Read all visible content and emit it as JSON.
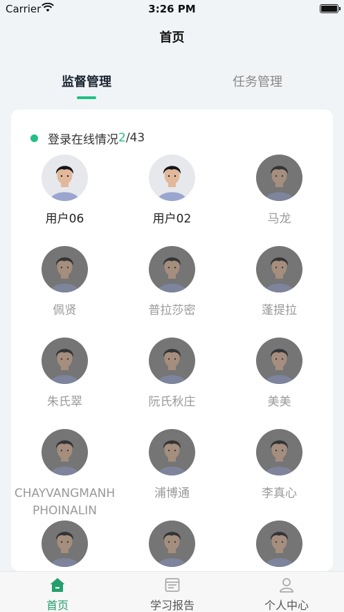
{
  "status_bar": {
    "carrier": "Carrier",
    "time": "3:26 PM"
  },
  "nav": {
    "title": "首页"
  },
  "tabs": [
    {
      "label": "监督管理",
      "active": true
    },
    {
      "label": "任务管理",
      "active": false
    }
  ],
  "online": {
    "label": "登录在线情况",
    "online_count": "2",
    "separator_total": "/43"
  },
  "users": [
    {
      "name": "用户06",
      "online": true
    },
    {
      "name": "用户02",
      "online": true
    },
    {
      "name": "马龙",
      "online": false
    },
    {
      "name": "佩贤",
      "online": false
    },
    {
      "name": "普拉莎密",
      "online": false
    },
    {
      "name": "蓬提拉",
      "online": false
    },
    {
      "name": "朱氏翠",
      "online": false
    },
    {
      "name": "阮氏秋庄",
      "online": false
    },
    {
      "name": "美美",
      "online": false
    },
    {
      "name": "CHAYVANGMANHPHOINALIN",
      "online": false
    },
    {
      "name": "浦博通",
      "online": false
    },
    {
      "name": "李真心",
      "online": false
    },
    {
      "name": "",
      "online": false
    },
    {
      "name": "",
      "online": false
    },
    {
      "name": "",
      "online": false
    }
  ],
  "tabbar": [
    {
      "label": "首页",
      "icon": "home-icon",
      "active": true
    },
    {
      "label": "学习报告",
      "icon": "report-icon",
      "active": false
    },
    {
      "label": "个人中心",
      "icon": "profile-icon",
      "active": false
    }
  ],
  "colors": {
    "accent": "#22c082",
    "background": "#f1f4f7"
  }
}
